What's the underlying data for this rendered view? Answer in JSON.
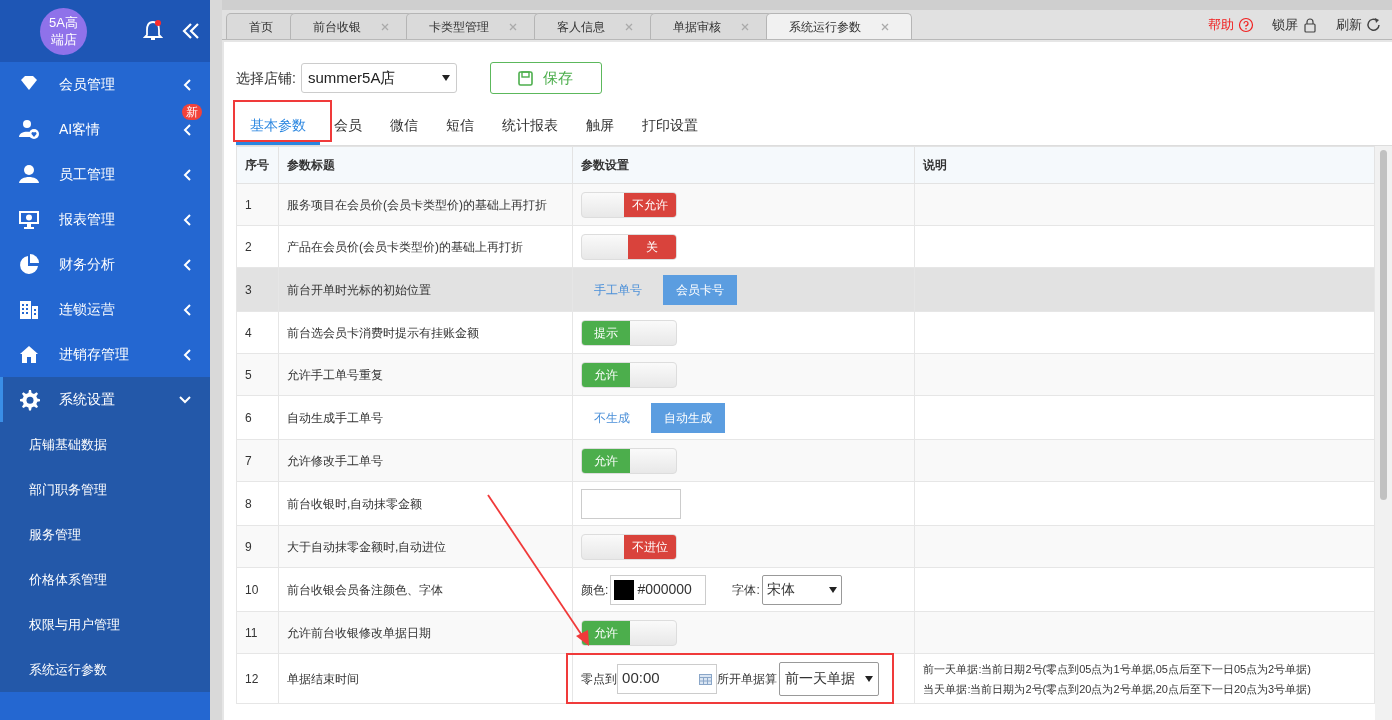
{
  "sidebar": {
    "logo": "5A高端店",
    "items": [
      {
        "label": "会员管理",
        "expanded": false
      },
      {
        "label": "AI客情",
        "expanded": false,
        "badge": "新"
      },
      {
        "label": "员工管理",
        "expanded": false
      },
      {
        "label": "报表管理",
        "expanded": false
      },
      {
        "label": "财务分析",
        "expanded": false
      },
      {
        "label": "连锁运营",
        "expanded": false
      },
      {
        "label": "进销存管理",
        "expanded": false
      },
      {
        "label": "系统设置",
        "expanded": true,
        "children": [
          {
            "label": "店铺基础数据"
          },
          {
            "label": "部门职务管理"
          },
          {
            "label": "服务管理"
          },
          {
            "label": "价格体系管理"
          },
          {
            "label": "权限与用户管理"
          },
          {
            "label": "系统运行参数"
          }
        ]
      }
    ]
  },
  "page_tabs": [
    {
      "label": "首页",
      "closable": false,
      "selected": false
    },
    {
      "label": "前台收银",
      "closable": true,
      "selected": false
    },
    {
      "label": "卡类型管理",
      "closable": true,
      "selected": false
    },
    {
      "label": "客人信息",
      "closable": true,
      "selected": false
    },
    {
      "label": "单据审核",
      "closable": true,
      "selected": false
    },
    {
      "label": "系统运行参数",
      "closable": true,
      "selected": true
    }
  ],
  "top_actions": [
    {
      "label": "帮助"
    },
    {
      "label": "锁屏"
    },
    {
      "label": "刷新"
    }
  ],
  "store": {
    "label": "选择店铺:",
    "value": "summer5A店"
  },
  "save_button": "保存",
  "param_tabs": [
    {
      "label": "基本参数",
      "selected": true
    },
    {
      "label": "会员",
      "selected": false
    },
    {
      "label": "微信",
      "selected": false
    },
    {
      "label": "短信",
      "selected": false
    },
    {
      "label": "统计报表",
      "selected": false
    },
    {
      "label": "触屏",
      "selected": false
    },
    {
      "label": "打印设置",
      "selected": false
    }
  ],
  "table": {
    "columns": [
      "序号",
      "参数标题",
      "参数设置",
      "说明"
    ],
    "rows": [
      {
        "no": "1",
        "title": "服务项目在会员价(会员卡类型价)的基础上再打折",
        "setting": {
          "kind": "toggle",
          "on": false,
          "label": "不允许"
        }
      },
      {
        "no": "2",
        "title": "产品在会员价(会员卡类型价)的基础上再打折",
        "setting": {
          "kind": "toggle",
          "on": false,
          "label": "关"
        }
      },
      {
        "no": "3",
        "title": "前台开单时光标的初始位置",
        "highlighted": true,
        "setting": {
          "kind": "choice",
          "options": [
            {
              "label": "手工单号",
              "selected": false
            },
            {
              "label": "会员卡号",
              "selected": true
            }
          ]
        }
      },
      {
        "no": "4",
        "title": "前台选会员卡消费时提示有挂账金额",
        "setting": {
          "kind": "toggle",
          "on": true,
          "label": "提示"
        }
      },
      {
        "no": "5",
        "title": "允许手工单号重复",
        "setting": {
          "kind": "toggle",
          "on": true,
          "label": "允许"
        }
      },
      {
        "no": "6",
        "title": "自动生成手工单号",
        "setting": {
          "kind": "choice",
          "options": [
            {
              "label": "不生成",
              "selected": false
            },
            {
              "label": "自动生成",
              "selected": true
            }
          ]
        }
      },
      {
        "no": "7",
        "title": "允许修改手工单号",
        "setting": {
          "kind": "toggle",
          "on": true,
          "label": "允许"
        }
      },
      {
        "no": "8",
        "title": "前台收银时,自动抹零金额",
        "setting": {
          "kind": "input"
        }
      },
      {
        "no": "9",
        "title": "大于自动抹零金额时,自动进位",
        "setting": {
          "kind": "toggle",
          "on": false,
          "label": "不进位"
        }
      },
      {
        "no": "10",
        "title": "前台收银会员备注颜色、字体",
        "setting": {
          "kind": "color_font",
          "color_label": "颜色:",
          "color": "#000000",
          "color_value": "#000000",
          "font_label": "字体:",
          "font": "宋体"
        }
      },
      {
        "no": "11",
        "title": "允许前台收银修改单据日期",
        "setting": {
          "kind": "toggle",
          "on": true,
          "label": "允许"
        }
      },
      {
        "no": "12",
        "title": "单据结束时间",
        "setting": {
          "kind": "time_range",
          "prefix": "零点到",
          "time": "00:00",
          "middle": "所开单据算",
          "option": "前一天单据"
        },
        "notes": [
          "前一天单据:当前日期2号(零点到05点为1号单据,05点后至下一日05点为2号单据)",
          "当天单据:当前日期为2号(零点到20点为2号单据,20点后至下一日20点为3号单据)"
        ]
      }
    ]
  }
}
